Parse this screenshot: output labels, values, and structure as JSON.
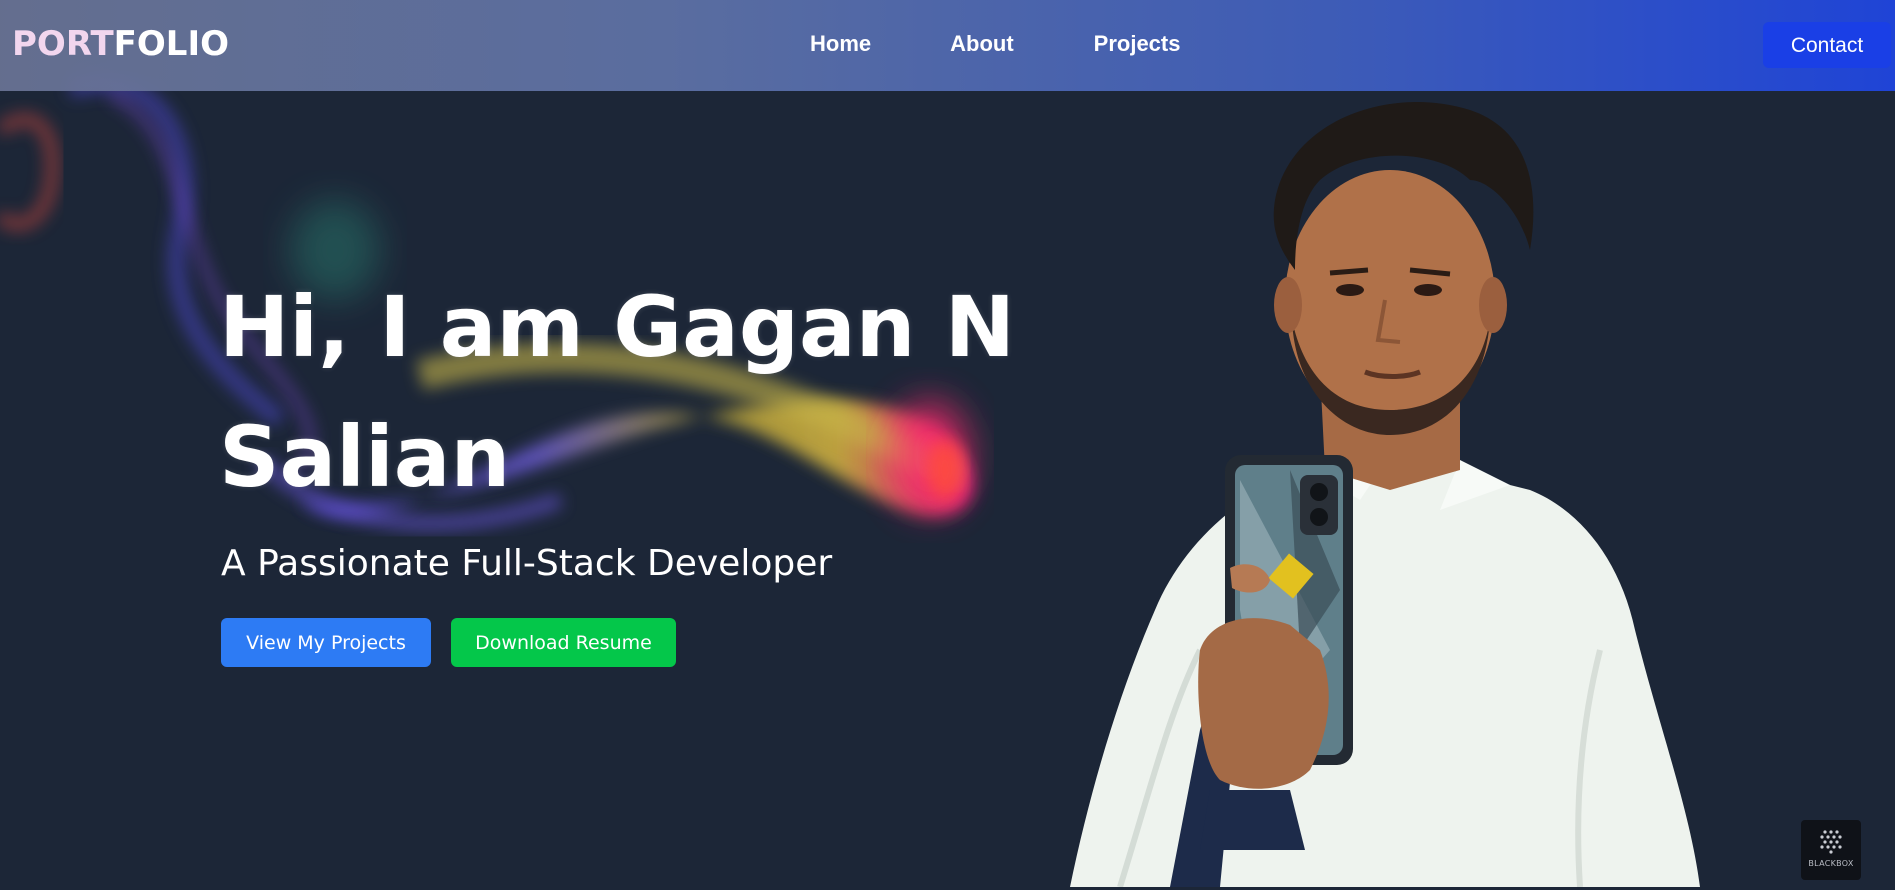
{
  "navbar": {
    "logo_part1": "PORT",
    "logo_part2": "FOLIO",
    "links": [
      {
        "label": "Home"
      },
      {
        "label": "About"
      },
      {
        "label": "Projects"
      }
    ],
    "contact_label": "Contact"
  },
  "hero": {
    "title_line1": "Hi, I am Gagan N",
    "title_line2": "Salian",
    "subtitle": "A Passionate Full-Stack Developer",
    "primary_button": "View My Projects",
    "secondary_button": "Download Resume"
  },
  "badge": {
    "label": "BLACKBOX"
  },
  "colors": {
    "background": "#1c2637",
    "navbar_start": "#6a7496",
    "navbar_end": "#1f44d6",
    "contact_button": "#1a3fe6",
    "primary_button": "#2d7bf4",
    "secondary_button": "#04c74a"
  }
}
